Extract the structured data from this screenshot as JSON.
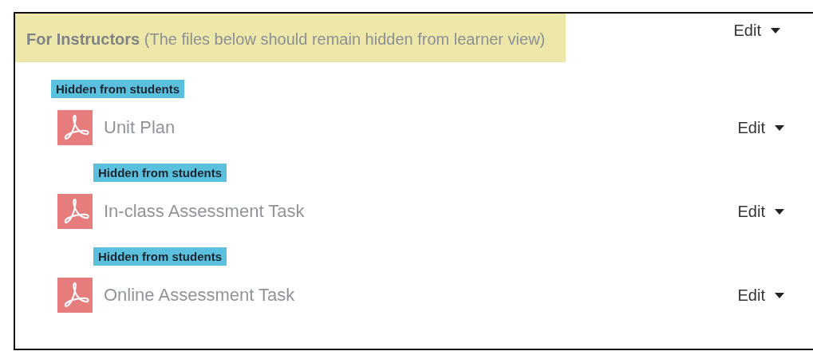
{
  "section": {
    "title": "**For Instructors** (The files below should remain hidden from learner view)",
    "edit": "Edit"
  },
  "items": [
    {
      "badge": "Hidden from students",
      "name": "Unit Plan",
      "hidden": true,
      "edit": "Edit"
    },
    {
      "badge": "Hidden from students",
      "name": "In-class Assessment Task",
      "hidden": true,
      "edit": "Edit"
    },
    {
      "badge": "Hidden from students",
      "name": "Online Assessment Task",
      "hidden": true,
      "edit": "Edit"
    }
  ]
}
